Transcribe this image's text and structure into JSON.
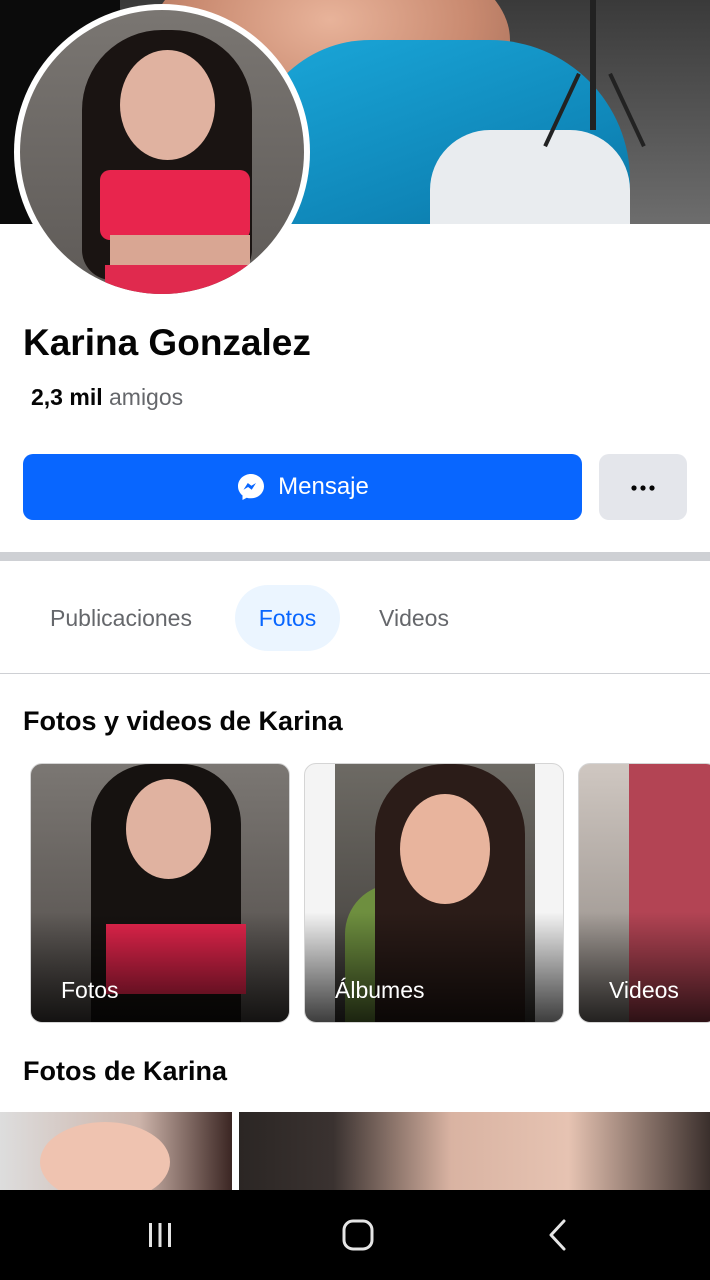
{
  "profile": {
    "name": "Karina Gonzalez",
    "friends_count": "2,3 mil",
    "friends_label": "amigos"
  },
  "actions": {
    "message_label": "Mensaje",
    "more_icon": "more-horizontal-icon",
    "message_icon": "messenger-icon"
  },
  "tabs": [
    {
      "label": "Publicaciones",
      "active": false
    },
    {
      "label": "Fotos",
      "active": true
    },
    {
      "label": "Videos",
      "active": false
    }
  ],
  "media_section": {
    "title": "Fotos y videos de Karina",
    "cards": [
      {
        "label": "Fotos"
      },
      {
        "label": "Álbumes"
      },
      {
        "label": "Videos"
      }
    ]
  },
  "photos_section": {
    "title": "Fotos de Karina"
  },
  "system_nav": {
    "recent_icon": "recent-apps-icon",
    "home_icon": "home-icon",
    "back_icon": "back-icon"
  },
  "colors": {
    "accent": "#0866ff",
    "tab_active_bg": "#ebf5ff",
    "secondary_text": "#65676b",
    "button_grey": "#e4e6eb"
  }
}
